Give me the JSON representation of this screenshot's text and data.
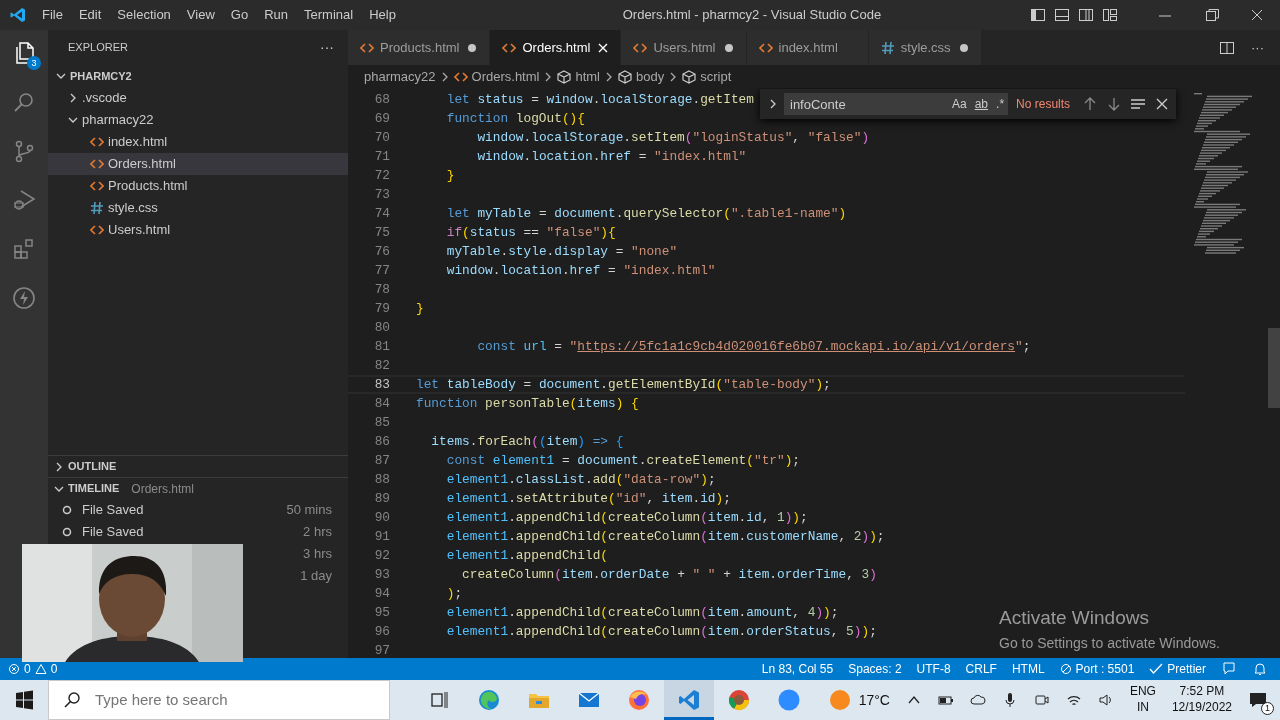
{
  "title_bar": {
    "menu": [
      "File",
      "Edit",
      "Selection",
      "View",
      "Go",
      "Run",
      "Terminal",
      "Help"
    ],
    "title": "Orders.html - pharmcy2 - Visual Studio Code"
  },
  "activity_bar": {
    "items": [
      {
        "kind": "explorer",
        "selected": true,
        "badge": "3"
      },
      {
        "kind": "search",
        "selected": false
      },
      {
        "kind": "source-control",
        "selected": false
      },
      {
        "kind": "run-debug",
        "selected": false
      },
      {
        "kind": "extensions",
        "selected": false
      },
      {
        "kind": "lightning",
        "selected": false
      }
    ]
  },
  "sidebar": {
    "title": "EXPLORER",
    "more": "···",
    "tree": {
      "label": "PHARMCY2",
      "expanded": true,
      "children": [
        {
          "label": ".vscode",
          "kind": "folder",
          "expanded": false
        },
        {
          "label": "pharmacy22",
          "kind": "folder",
          "expanded": true,
          "children": [
            {
              "label": "index.html",
              "kind": "html",
              "selected": false
            },
            {
              "label": "Orders.html",
              "kind": "html",
              "selected": true
            },
            {
              "label": "Products.html",
              "kind": "html",
              "selected": false
            },
            {
              "label": "style.css",
              "kind": "css",
              "selected": false
            },
            {
              "label": "Users.html",
              "kind": "html",
              "selected": false
            }
          ]
        }
      ]
    },
    "outline": {
      "label": "OUTLINE",
      "expanded": false
    },
    "timeline": {
      "label": "TIMELINE",
      "file": "Orders.html",
      "expanded": true,
      "items": [
        {
          "label": "File Saved",
          "time": "50 mins"
        },
        {
          "label": "File Saved",
          "time": "2 hrs"
        },
        {
          "time": "3 hrs"
        },
        {
          "time": "1 day"
        }
      ]
    }
  },
  "tabs": [
    {
      "label": "Products.html",
      "kind": "html",
      "selected": false,
      "modified": true
    },
    {
      "label": "Orders.html",
      "kind": "html",
      "selected": true,
      "modified": false
    },
    {
      "label": "Users.html",
      "kind": "html",
      "selected": false,
      "modified": true
    },
    {
      "label": "index.html",
      "kind": "html",
      "selected": false,
      "modified": false
    },
    {
      "label": "style.css",
      "kind": "css",
      "selected": false,
      "modified": true
    }
  ],
  "tab_actions": {
    "more": "···"
  },
  "breadcrumbs": [
    {
      "label": "pharmacy22",
      "kind": "folder"
    },
    {
      "label": "Orders.html",
      "kind": "html"
    },
    {
      "label": "html",
      "kind": "symbol"
    },
    {
      "label": "body",
      "kind": "symbol"
    },
    {
      "label": "script",
      "kind": "symbol"
    }
  ],
  "find": {
    "value": "infoConte",
    "options": [
      "Aa",
      "ab",
      ".*"
    ],
    "result": "No results"
  },
  "code": {
    "lines": [
      {
        "n": "68",
        "current": false,
        "tokens": [
          {
            "text": "    let",
            "kind": "keyword"
          },
          {
            "text": " status",
            "kind": "variable"
          },
          {
            "text": " = ",
            "kind": "plain"
          },
          {
            "text": "window",
            "kind": "variable"
          },
          {
            "text": ".",
            "kind": "plain"
          },
          {
            "text": "localStorage",
            "kind": "variable"
          },
          {
            "text": ".",
            "kind": "plain"
          },
          {
            "text": "getItem",
            "kind": "function"
          }
        ]
      },
      {
        "n": "69",
        "current": false,
        "tokens": [
          {
            "text": "    function",
            "kind": "keyword"
          },
          {
            "text": " logOut",
            "kind": "function"
          },
          {
            "text": "()",
            "kind": "bracket1"
          },
          {
            "text": "{",
            "kind": "bracket1"
          }
        ]
      },
      {
        "n": "70",
        "current": false,
        "tokens": [
          {
            "text": "        window",
            "kind": "variable"
          },
          {
            "text": ".",
            "kind": "plain"
          },
          {
            "text": "localStorage",
            "kind": "variable"
          },
          {
            "text": ".",
            "kind": "plain"
          },
          {
            "text": "setItem",
            "kind": "function"
          },
          {
            "text": "(",
            "kind": "bracket2"
          },
          {
            "text": "\"loginStatus\"",
            "kind": "string"
          },
          {
            "text": ", ",
            "kind": "plain"
          },
          {
            "text": "\"false\"",
            "kind": "string"
          },
          {
            "text": ")",
            "kind": "bracket2"
          }
        ]
      },
      {
        "n": "71",
        "current": false,
        "tokens": [
          {
            "text": "        window",
            "kind": "variable"
          },
          {
            "text": ".",
            "kind": "plain"
          },
          {
            "text": "location",
            "kind": "variable"
          },
          {
            "text": ".",
            "kind": "plain"
          },
          {
            "text": "href",
            "kind": "variable"
          },
          {
            "text": " = ",
            "kind": "plain"
          },
          {
            "text": "\"index.html\"",
            "kind": "string"
          }
        ]
      },
      {
        "n": "72",
        "current": false,
        "tokens": [
          {
            "text": "    }",
            "kind": "bracket1"
          }
        ]
      },
      {
        "n": "73",
        "current": false
      },
      {
        "n": "74",
        "current": false,
        "tokens": [
          {
            "text": "    let",
            "kind": "keyword"
          },
          {
            "text": " myTable",
            "kind": "variable"
          },
          {
            "text": " = ",
            "kind": "plain"
          },
          {
            "text": "document",
            "kind": "variable"
          },
          {
            "text": ".",
            "kind": "plain"
          },
          {
            "text": "querySelector",
            "kind": "function"
          },
          {
            "text": "(",
            "kind": "bracket1"
          },
          {
            "text": "\".table1-name\"",
            "kind": "string"
          },
          {
            "text": ")",
            "kind": "bracket1"
          }
        ]
      },
      {
        "n": "75",
        "current": false,
        "tokens": [
          {
            "text": "    if",
            "kind": "control"
          },
          {
            "text": "(",
            "kind": "bracket1"
          },
          {
            "text": "status",
            "kind": "variable"
          },
          {
            "text": " == ",
            "kind": "plain"
          },
          {
            "text": "\"false\"",
            "kind": "string"
          },
          {
            "text": ")",
            "kind": "bracket1"
          },
          {
            "text": "{",
            "kind": "bracket1"
          }
        ]
      },
      {
        "n": "76",
        "current": false,
        "tokens": [
          {
            "text": "    myTable",
            "kind": "variable"
          },
          {
            "text": ".",
            "kind": "plain"
          },
          {
            "text": "style",
            "kind": "variable"
          },
          {
            "text": ".",
            "kind": "plain"
          },
          {
            "text": "display",
            "kind": "variable"
          },
          {
            "text": " = ",
            "kind": "plain"
          },
          {
            "text": "\"none\"",
            "kind": "string"
          }
        ]
      },
      {
        "n": "77",
        "current": false,
        "tokens": [
          {
            "text": "    window",
            "kind": "variable"
          },
          {
            "text": ".",
            "kind": "plain"
          },
          {
            "text": "location",
            "kind": "variable"
          },
          {
            "text": ".",
            "kind": "plain"
          },
          {
            "text": "href",
            "kind": "variable"
          },
          {
            "text": " = ",
            "kind": "plain"
          },
          {
            "text": "\"index.html\"",
            "kind": "string"
          }
        ]
      },
      {
        "n": "78",
        "current": false
      },
      {
        "n": "79",
        "current": false,
        "tokens": [
          {
            "text": "}",
            "kind": "bracket1"
          }
        ]
      },
      {
        "n": "80",
        "current": false
      },
      {
        "n": "81",
        "current": false,
        "tokens": [
          {
            "text": "        const",
            "kind": "keyword"
          },
          {
            "text": " url",
            "kind": "constant"
          },
          {
            "text": " = ",
            "kind": "plain"
          },
          {
            "text": "\"",
            "kind": "string"
          },
          {
            "text": "https://5fc1a1c9cb4d020016fe6b07.mockapi.io/api/v1/orders",
            "kind": "link"
          },
          {
            "text": "\"",
            "kind": "string"
          },
          {
            "text": ";",
            "kind": "plain"
          }
        ]
      },
      {
        "n": "82",
        "current": false
      },
      {
        "n": "83",
        "current": true,
        "tokens": [
          {
            "text": "let",
            "kind": "keyword"
          },
          {
            "text": " tableBody",
            "kind": "variable"
          },
          {
            "text": " = ",
            "kind": "plain"
          },
          {
            "text": "document",
            "kind": "variable"
          },
          {
            "text": ".",
            "kind": "plain"
          },
          {
            "text": "getElementById",
            "kind": "function"
          },
          {
            "text": "(",
            "kind": "bracket1"
          },
          {
            "text": "\"table-body\"",
            "kind": "string"
          },
          {
            "text": ")",
            "kind": "bracket1"
          },
          {
            "text": ";",
            "kind": "plain"
          }
        ]
      },
      {
        "n": "84",
        "current": false,
        "tokens": [
          {
            "text": "function",
            "kind": "keyword"
          },
          {
            "text": " personTable",
            "kind": "function"
          },
          {
            "text": "(",
            "kind": "bracket1"
          },
          {
            "text": "items",
            "kind": "variable"
          },
          {
            "text": ")",
            "kind": "bracket1"
          },
          {
            "text": " {",
            "kind": "bracket1"
          }
        ]
      },
      {
        "n": "85",
        "current": false
      },
      {
        "n": "86",
        "current": false,
        "tokens": [
          {
            "text": "  items",
            "kind": "variable"
          },
          {
            "text": ".",
            "kind": "plain"
          },
          {
            "text": "forEach",
            "kind": "function"
          },
          {
            "text": "(",
            "kind": "bracket2"
          },
          {
            "text": "(",
            "kind": "bracket3"
          },
          {
            "text": "item",
            "kind": "variable"
          },
          {
            "text": ")",
            "kind": "bracket3"
          },
          {
            "text": " =>",
            "kind": "keyword"
          },
          {
            "text": " {",
            "kind": "bracket3"
          }
        ]
      },
      {
        "n": "87",
        "current": false,
        "tokens": [
          {
            "text": "    const",
            "kind": "keyword"
          },
          {
            "text": " element1",
            "kind": "constant"
          },
          {
            "text": " = ",
            "kind": "plain"
          },
          {
            "text": "document",
            "kind": "variable"
          },
          {
            "text": ".",
            "kind": "plain"
          },
          {
            "text": "createElement",
            "kind": "function"
          },
          {
            "text": "(",
            "kind": "bracket1"
          },
          {
            "text": "\"tr\"",
            "kind": "string"
          },
          {
            "text": ")",
            "kind": "bracket1"
          },
          {
            "text": ";",
            "kind": "plain"
          }
        ]
      },
      {
        "n": "88",
        "current": false,
        "tokens": [
          {
            "text": "    element1",
            "kind": "constant"
          },
          {
            "text": ".",
            "kind": "plain"
          },
          {
            "text": "classList",
            "kind": "variable"
          },
          {
            "text": ".",
            "kind": "plain"
          },
          {
            "text": "add",
            "kind": "function"
          },
          {
            "text": "(",
            "kind": "bracket1"
          },
          {
            "text": "\"data-row\"",
            "kind": "string"
          },
          {
            "text": ")",
            "kind": "bracket1"
          },
          {
            "text": ";",
            "kind": "plain"
          }
        ]
      },
      {
        "n": "89",
        "current": false,
        "tokens": [
          {
            "text": "    element1",
            "kind": "constant"
          },
          {
            "text": ".",
            "kind": "plain"
          },
          {
            "text": "setAttribute",
            "kind": "function"
          },
          {
            "text": "(",
            "kind": "bracket1"
          },
          {
            "text": "\"id\"",
            "kind": "string"
          },
          {
            "text": ", ",
            "kind": "plain"
          },
          {
            "text": "item",
            "kind": "variable"
          },
          {
            "text": ".",
            "kind": "plain"
          },
          {
            "text": "id",
            "kind": "variable"
          },
          {
            "text": ")",
            "kind": "bracket1"
          },
          {
            "text": ";",
            "kind": "plain"
          }
        ]
      },
      {
        "n": "90",
        "current": false,
        "tokens": [
          {
            "text": "    element1",
            "kind": "constant"
          },
          {
            "text": ".",
            "kind": "plain"
          },
          {
            "text": "appendChild",
            "kind": "function"
          },
          {
            "text": "(",
            "kind": "bracket1"
          },
          {
            "text": "createColumn",
            "kind": "function"
          },
          {
            "text": "(",
            "kind": "bracket2"
          },
          {
            "text": "item",
            "kind": "variable"
          },
          {
            "text": ".",
            "kind": "plain"
          },
          {
            "text": "id",
            "kind": "variable"
          },
          {
            "text": ", ",
            "kind": "plain"
          },
          {
            "text": "1",
            "kind": "number"
          },
          {
            "text": ")",
            "kind": "bracket2"
          },
          {
            "text": ")",
            "kind": "bracket1"
          },
          {
            "text": ";",
            "kind": "plain"
          }
        ]
      },
      {
        "n": "91",
        "current": false,
        "tokens": [
          {
            "text": "    element1",
            "kind": "constant"
          },
          {
            "text": ".",
            "kind": "plain"
          },
          {
            "text": "appendChild",
            "kind": "function"
          },
          {
            "text": "(",
            "kind": "bracket1"
          },
          {
            "text": "createColumn",
            "kind": "function"
          },
          {
            "text": "(",
            "kind": "bracket2"
          },
          {
            "text": "item",
            "kind": "variable"
          },
          {
            "text": ".",
            "kind": "plain"
          },
          {
            "text": "customerName",
            "kind": "variable"
          },
          {
            "text": ", ",
            "kind": "plain"
          },
          {
            "text": "2",
            "kind": "number"
          },
          {
            "text": ")",
            "kind": "bracket2"
          },
          {
            "text": ")",
            "kind": "bracket1"
          },
          {
            "text": ";",
            "kind": "plain"
          }
        ]
      },
      {
        "n": "92",
        "current": false,
        "tokens": [
          {
            "text": "    element1",
            "kind": "constant"
          },
          {
            "text": ".",
            "kind": "plain"
          },
          {
            "text": "appendChild",
            "kind": "function"
          },
          {
            "text": "(",
            "kind": "bracket1"
          }
        ]
      },
      {
        "n": "93",
        "current": false,
        "tokens": [
          {
            "text": "      createColumn",
            "kind": "function"
          },
          {
            "text": "(",
            "kind": "bracket2"
          },
          {
            "text": "item",
            "kind": "variable"
          },
          {
            "text": ".",
            "kind": "plain"
          },
          {
            "text": "orderDate",
            "kind": "variable"
          },
          {
            "text": " + ",
            "kind": "plain"
          },
          {
            "text": "\" \"",
            "kind": "string"
          },
          {
            "text": " + ",
            "kind": "plain"
          },
          {
            "text": "item",
            "kind": "variable"
          },
          {
            "text": ".",
            "kind": "plain"
          },
          {
            "text": "orderTime",
            "kind": "variable"
          },
          {
            "text": ", ",
            "kind": "plain"
          },
          {
            "text": "3",
            "kind": "number"
          },
          {
            "text": ")",
            "kind": "bracket2"
          }
        ]
      },
      {
        "n": "94",
        "current": false,
        "tokens": [
          {
            "text": "    )",
            "kind": "bracket1"
          },
          {
            "text": ";",
            "kind": "plain"
          }
        ]
      },
      {
        "n": "95",
        "current": false,
        "tokens": [
          {
            "text": "    element1",
            "kind": "constant"
          },
          {
            "text": ".",
            "kind": "plain"
          },
          {
            "text": "appendChild",
            "kind": "function"
          },
          {
            "text": "(",
            "kind": "bracket1"
          },
          {
            "text": "createColumn",
            "kind": "function"
          },
          {
            "text": "(",
            "kind": "bracket2"
          },
          {
            "text": "item",
            "kind": "variable"
          },
          {
            "text": ".",
            "kind": "plain"
          },
          {
            "text": "amount",
            "kind": "variable"
          },
          {
            "text": ", ",
            "kind": "plain"
          },
          {
            "text": "4",
            "kind": "number"
          },
          {
            "text": ")",
            "kind": "bracket2"
          },
          {
            "text": ")",
            "kind": "bracket1"
          },
          {
            "text": ";",
            "kind": "plain"
          }
        ]
      },
      {
        "n": "96",
        "current": false,
        "tokens": [
          {
            "text": "    element1",
            "kind": "constant"
          },
          {
            "text": ".",
            "kind": "plain"
          },
          {
            "text": "appendChild",
            "kind": "function"
          },
          {
            "text": "(",
            "kind": "bracket1"
          },
          {
            "text": "createColumn",
            "kind": "function"
          },
          {
            "text": "(",
            "kind": "bracket2"
          },
          {
            "text": "item",
            "kind": "variable"
          },
          {
            "text": ".",
            "kind": "plain"
          },
          {
            "text": "orderStatus",
            "kind": "variable"
          },
          {
            "text": ", ",
            "kind": "plain"
          },
          {
            "text": "5",
            "kind": "number"
          },
          {
            "text": ")",
            "kind": "bracket2"
          },
          {
            "text": ")",
            "kind": "bracket1"
          },
          {
            "text": ";",
            "kind": "plain"
          }
        ]
      },
      {
        "n": "97",
        "current": false
      }
    ]
  },
  "status_bar": {
    "errors": "0",
    "warnings": "0",
    "items": [
      {
        "label": "Ln 83, Col 55"
      },
      {
        "label": "Spaces: 2"
      },
      {
        "label": "UTF-8"
      },
      {
        "label": "CRLF"
      },
      {
        "label": "HTML"
      },
      {
        "label": "Port : 5501",
        "kind": "port"
      },
      {
        "label": "Prettier",
        "kind": "check"
      }
    ]
  },
  "taskbar": {
    "search_placeholder": "Type here to search",
    "apps": [
      {
        "kind": "task-view",
        "selected": false
      },
      {
        "kind": "edge",
        "selected": false
      },
      {
        "kind": "folder",
        "selected": false
      },
      {
        "kind": "mail",
        "selected": false
      },
      {
        "kind": "firefox",
        "selected": false
      },
      {
        "kind": "vscode",
        "selected": true
      },
      {
        "kind": "chrome",
        "selected": false
      },
      {
        "kind": "zoom",
        "selected": false
      }
    ],
    "weather": "17°C",
    "language": [
      "ENG",
      "IN"
    ],
    "time": "7:52 PM",
    "date": "12/19/2022",
    "notifications": "1"
  },
  "activation_notice": {
    "title": "Activate Windows",
    "text": "Go to Settings to activate Windows."
  }
}
